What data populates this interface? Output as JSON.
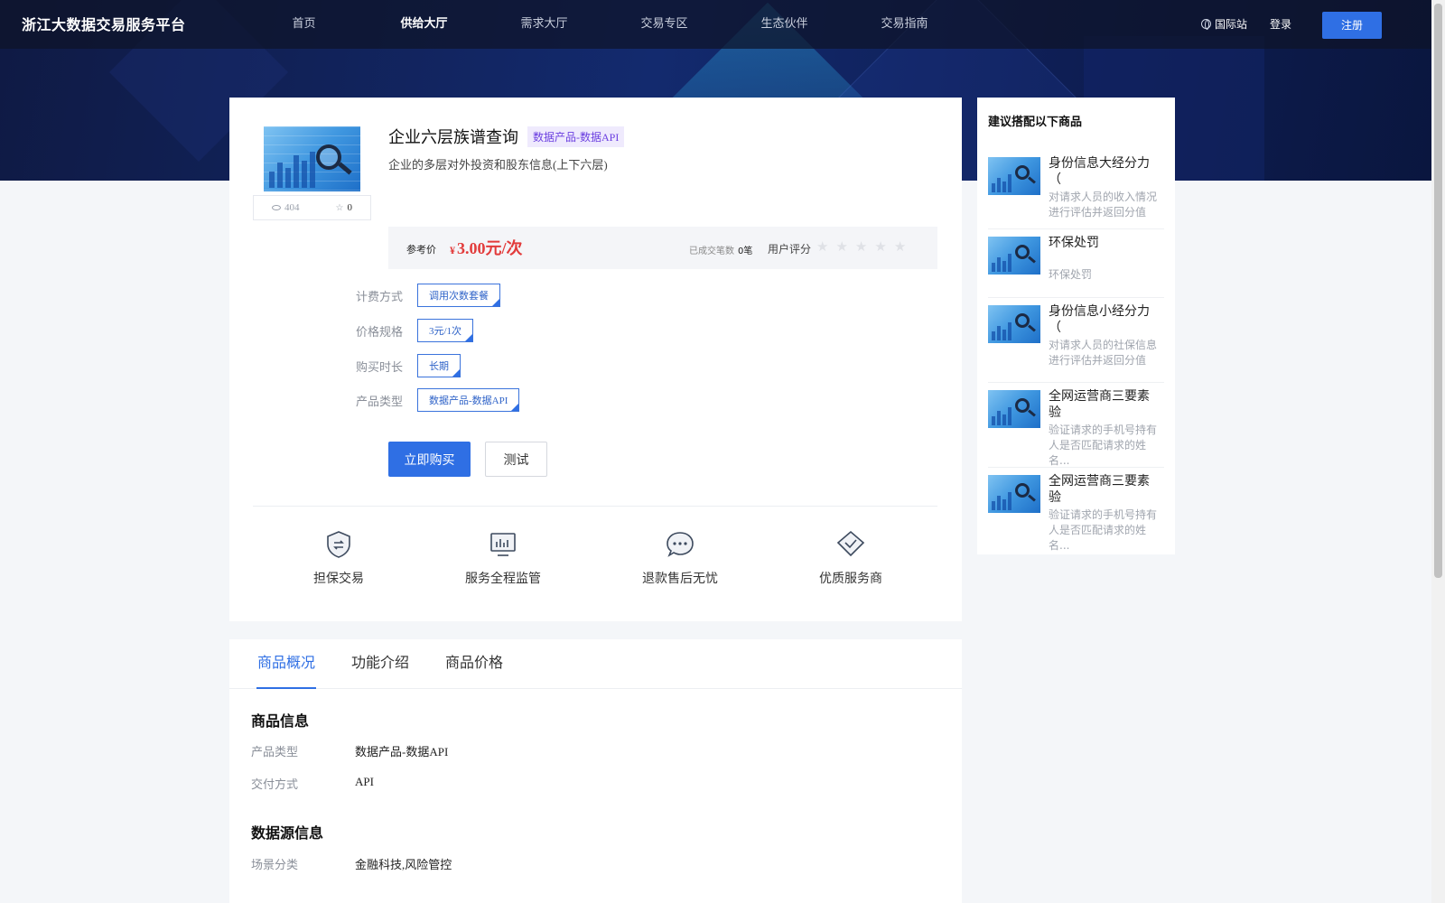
{
  "header": {
    "logo": "浙江大数据交易服务平台",
    "nav": [
      "首页",
      "供给大厅",
      "需求大厅",
      "交易专区",
      "生态伙伴",
      "交易指南"
    ],
    "active_nav": 1,
    "intl": "国际站",
    "login": "登录",
    "register": "注册"
  },
  "product": {
    "title": "企业六层族谱查询",
    "tag": "数据产品-数据API",
    "description": "企业的多层对外投资和股东信息(上下六层)",
    "views": "404",
    "favorites": "0",
    "price_label": "参考价",
    "price_currency": "¥",
    "price": "3.00元/次",
    "deals_label": "已成交笔数",
    "deals": "0笔",
    "rating_label": "用户评分",
    "rating": 0,
    "rating_max": 5,
    "specs": [
      {
        "label": "计费方式",
        "value": "调用次数套餐"
      },
      {
        "label": "价格规格",
        "value": "3元/1次"
      },
      {
        "label": "购买时长",
        "value": "长期"
      },
      {
        "label": "产品类型",
        "value": "数据产品-数据API"
      }
    ],
    "buy_label": "立即购买",
    "test_label": "测试"
  },
  "features": [
    {
      "label": "担保交易",
      "icon": "shield-exchange-icon"
    },
    {
      "label": "服务全程监管",
      "icon": "monitor-chart-icon"
    },
    {
      "label": "退款售后无忧",
      "icon": "chat-bubble-icon"
    },
    {
      "label": "优质服务商",
      "icon": "diamond-check-icon"
    }
  ],
  "tabs": [
    "商品概况",
    "功能介绍",
    "商品价格"
  ],
  "active_tab": 0,
  "details": {
    "section1_title": "商品信息",
    "rows1": [
      {
        "k": "产品类型",
        "v": "数据产品-数据API"
      },
      {
        "k": "交付方式",
        "v": "API"
      }
    ],
    "section2_title": "数据源信息",
    "rows2": [
      {
        "k": "场景分类",
        "v": "金融科技,风险管控"
      }
    ]
  },
  "side": {
    "title": "建议搭配以下商品",
    "items": [
      {
        "name": "身份信息大经分力（",
        "desc": "对请求人员的收入情况进行评估并返回分值"
      },
      {
        "name": "环保处罚",
        "desc": "环保处罚"
      },
      {
        "name": "身份信息小经分力（",
        "desc": "对请求人员的社保信息进行评估并返回分值"
      },
      {
        "name": "全网运营商三要素验",
        "desc": "验证请求的手机号持有人是否匹配请求的姓名..."
      },
      {
        "name": "全网运营商三要素验",
        "desc": "验证请求的手机号持有人是否匹配请求的姓名..."
      }
    ]
  },
  "colors": {
    "primary": "#2f6fe4",
    "price": "#e23b3b",
    "tag_bg": "#efeafd",
    "tag_text": "#6b3fe0",
    "header_bg": "#0f1a44"
  }
}
